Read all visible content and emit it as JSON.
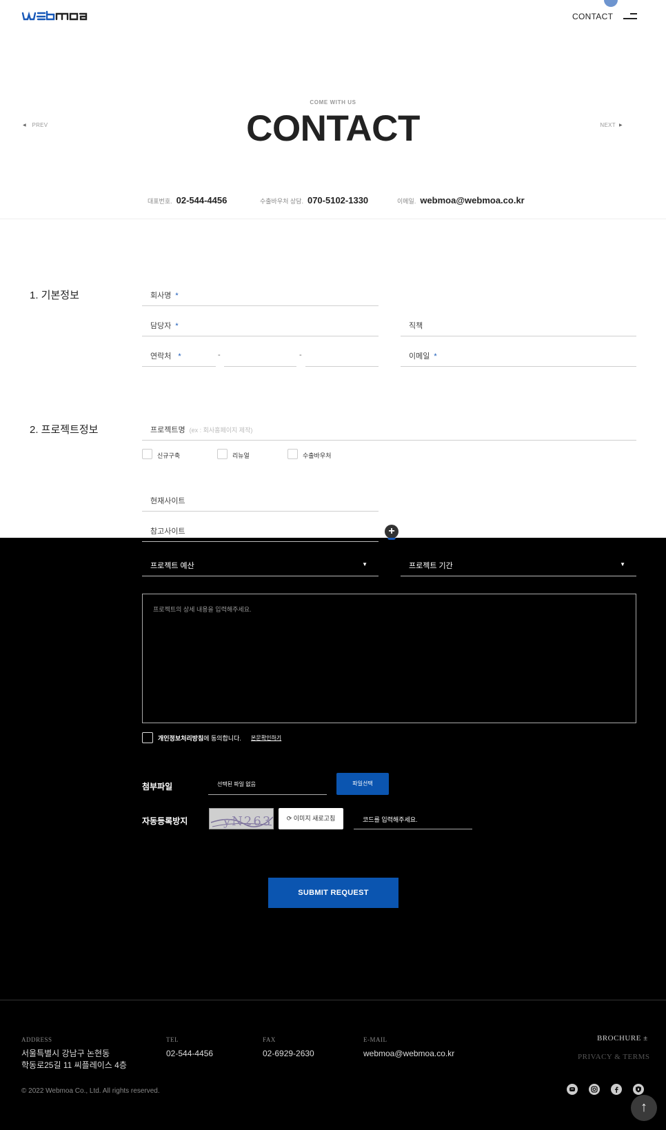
{
  "header": {
    "brand": "webmoa",
    "nav_contact": "CONTACT"
  },
  "hero": {
    "eyebrow": "COME WITH US",
    "title": "CONTACT",
    "prev": "PREV",
    "next": "NEXT"
  },
  "contact_info": {
    "main_label": "대표번호.",
    "main_value": "02-544-4456",
    "voucher_label": "수출바우처 상담.",
    "voucher_value": "070-5102-1330",
    "email_label": "이메일.",
    "email_value": "webmoa@webmoa.co.kr"
  },
  "form": {
    "section1": "1. 기본정보",
    "company": "회사명",
    "manager": "담당자",
    "position": "직책",
    "phone": "연락처",
    "email": "이메일",
    "required_mark": "*",
    "dash": "-",
    "section2": "2. 프로젝트정보",
    "project_name": "프로젝트명",
    "project_name_ph": "(ex : 회사홈페이지 제작)",
    "types": [
      "신규구축",
      "리뉴얼",
      "수출바우처"
    ],
    "current_site": "현재사이트",
    "ref_site": "참고사이트",
    "plus": "+",
    "budget": "프로젝트 예산",
    "period": "프로젝트 기간",
    "caret": "▼",
    "textarea_ph": "프로젝트의 상세 내용을 입력해주세요.",
    "agree_text_bold": "개인정보처리방침",
    "agree_text": "에 동의합니다.",
    "agree_link": "본문확인하기",
    "attach_label": "첨부파일",
    "attach_value": "선택된 파일 없음",
    "attach_btn": "파일선택",
    "captcha_label": "자동등록방지",
    "captcha_code": "yN263",
    "refresh_btn": "⟳ 이미지 새로고침",
    "code_ph": "코드를 입력해주세요.",
    "submit": "SUBMIT REQUEST"
  },
  "footer": {
    "address_label": "ADDRESS",
    "address_line1": "서울특별시 강남구 논현동",
    "address_line2": "학동로25길 11 씨플레이스 4층",
    "tel_label": "TEL",
    "tel_value": "02-544-4456",
    "fax_label": "FAX",
    "fax_value": "02-6929-2630",
    "email_label": "E-MAIL",
    "email_value": "webmoa@webmoa.co.kr",
    "brochure": "BROCHURE ±",
    "privacy": "PRIVACY & TERMS",
    "copyright": "© 2022 Webmoa Co., Ltd. All rights reserved.",
    "top_arrow": "↑"
  },
  "colors": {
    "accent": "#0b55b0",
    "dark_bg": "#000000"
  }
}
